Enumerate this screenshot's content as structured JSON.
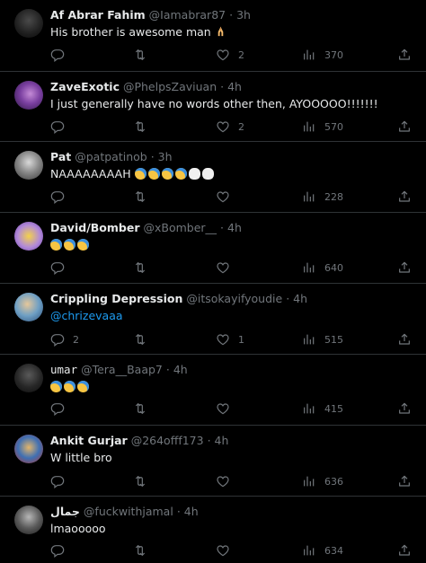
{
  "colors": {
    "background": "#000000",
    "text": "#e7e9ea",
    "muted": "#71767b",
    "link": "#1d9bf0",
    "divider": "#2f3336"
  },
  "icons": {
    "reply": "reply-icon",
    "retweet": "retweet-icon",
    "like": "heart-icon",
    "views": "views-icon",
    "share": "share-icon"
  },
  "tweets": [
    {
      "name": "Af Abrar Fahim",
      "handle": "@Iamabrar87",
      "sep": "·",
      "time": "3h",
      "text": "His brother is awesome man",
      "replies": "",
      "likes": "2",
      "views": "370"
    },
    {
      "name": "ZaveExotic",
      "handle": "@PhelpsZaviuan",
      "sep": "·",
      "time": "4h",
      "text": "I just generally have no words other then, AYOOOOO!!!!!!!",
      "replies": "",
      "likes": "2",
      "views": "570"
    },
    {
      "name": "Pat",
      "handle": "@patpatinob",
      "sep": "·",
      "time": "3h",
      "text": "NAAAAAAAAH",
      "replies": "",
      "likes": "",
      "views": "228"
    },
    {
      "name": "David/Bomber",
      "handle": "@xBomber__",
      "sep": "·",
      "time": "4h",
      "text": "",
      "replies": "",
      "likes": "",
      "views": "640"
    },
    {
      "name": "Crippling Depression",
      "handle": "@itsokayifyoudie",
      "sep": "·",
      "time": "4h",
      "text": "@chrizevaaa",
      "replies": "2",
      "likes": "1",
      "views": "515"
    },
    {
      "name": "umar",
      "handle": "@Tera__Baap7",
      "sep": "·",
      "time": "4h",
      "text": "",
      "replies": "",
      "likes": "",
      "views": "415"
    },
    {
      "name": "Ankit Gurjar",
      "handle": "@264offf173",
      "sep": "·",
      "time": "4h",
      "text": "W little bro",
      "replies": "",
      "likes": "",
      "views": "636"
    },
    {
      "name": "جمال",
      "handle": "@fuckwithjamal",
      "sep": "·",
      "time": "4h",
      "text": "lmaooooo",
      "replies": "",
      "likes": "",
      "views": "634"
    }
  ]
}
